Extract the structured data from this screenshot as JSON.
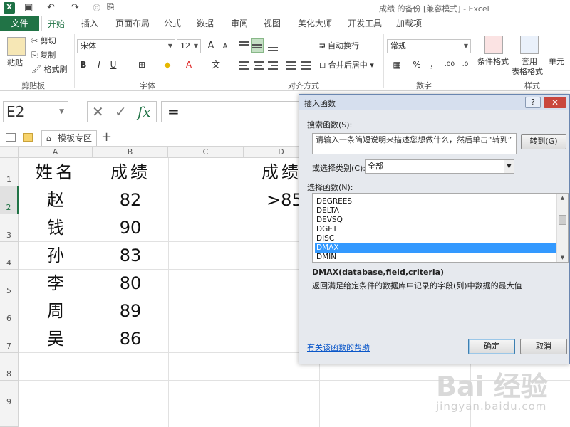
{
  "window": {
    "title": "成绩 的备份  [兼容模式] - Excel",
    "app_logo": "X"
  },
  "quick_access": [
    "save-icon",
    "undo-icon",
    "redo-icon",
    "touch-icon",
    "customize-icon"
  ],
  "tabs": {
    "file": "文件",
    "items": [
      "开始",
      "插入",
      "页面布局",
      "公式",
      "数据",
      "审阅",
      "视图",
      "美化大师",
      "开发工具",
      "加载项"
    ],
    "active": "开始"
  },
  "ribbon": {
    "clipboard": {
      "paste": "粘贴",
      "cut": "剪切",
      "copy": "复制",
      "format_painter": "格式刷",
      "label": "剪贴板"
    },
    "font": {
      "name": "宋体",
      "size": "12",
      "bold": "B",
      "italic": "I",
      "underline": "U",
      "grow": "A",
      "shrink": "A",
      "label": "字体",
      "wen": "文"
    },
    "alignment": {
      "wrap": "自动换行",
      "merge": "合并后居中",
      "label": "对齐方式"
    },
    "number": {
      "format": "常规",
      "percent": "%",
      "comma": "，",
      "label": "数字"
    },
    "styles": {
      "conditional": "条件格式",
      "table1": "套用",
      "table2": "表格格式",
      "cell": "单元",
      "label": "样式"
    }
  },
  "formula_bar": {
    "name_box": "E2",
    "cancel": "✕",
    "enter": "✓",
    "fx": "fx",
    "content": "="
  },
  "file_tabs": {
    "template": "模板专区",
    "plus": "+"
  },
  "sheet": {
    "columns": [
      "A",
      "B",
      "C",
      "D"
    ],
    "rows": [
      "1",
      "2",
      "3",
      "4",
      "5",
      "6",
      "7",
      "8",
      "9"
    ],
    "header": {
      "name": "姓名",
      "score": "成绩",
      "criteria_header": "成绩"
    },
    "criteria_value": ">85",
    "data": [
      {
        "name": "赵",
        "score": "82"
      },
      {
        "name": "钱",
        "score": "90"
      },
      {
        "name": "孙",
        "score": "83"
      },
      {
        "name": "李",
        "score": "80"
      },
      {
        "name": "周",
        "score": "89"
      },
      {
        "name": "吴",
        "score": "86"
      }
    ]
  },
  "dialog": {
    "title": "插入函数",
    "help": "?",
    "close": "✕",
    "search_label": "搜索函数(S):",
    "search_placeholder": "请输入一条简短说明来描述您想做什么，然后单击“转到”",
    "go": "转到(G)",
    "category_label": "或选择类别(C):",
    "category_value": "全部",
    "select_label": "选择函数(N):",
    "functions": [
      "DEGREES",
      "DELTA",
      "DEVSQ",
      "DGET",
      "DISC",
      "DMAX",
      "DMIN"
    ],
    "selected": "DMAX",
    "signature": "DMAX(database,field,criteria)",
    "description": "返回满足给定条件的数据库中记录的字段(列)中数据的最大值",
    "help_link": "有关该函数的帮助",
    "ok": "确定",
    "cancel": "取消"
  },
  "watermark": {
    "big": "Bai 经验",
    "small": "jingyan.baidu.com"
  }
}
